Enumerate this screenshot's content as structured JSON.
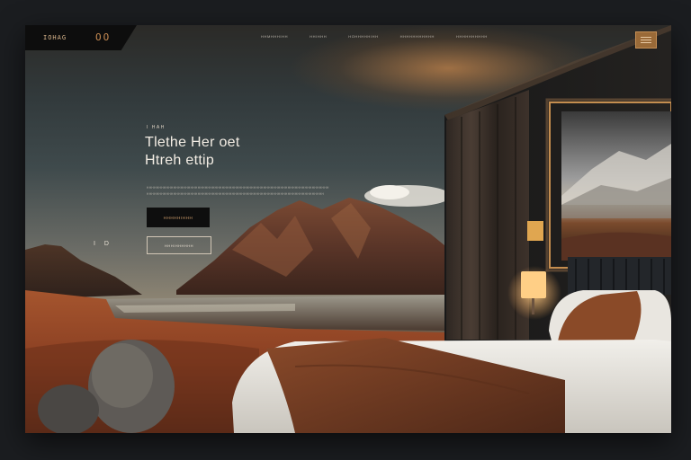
{
  "nav": {
    "logo_text": "IOHAG",
    "logo_mark": "OO",
    "items": [
      "HHMHHHIHH",
      "HHIHHH",
      "HOHHHHHIHH",
      "HHHHHHHHHHH",
      "HHHHHHHHHH"
    ]
  },
  "hero": {
    "eyebrow": "I HAH",
    "headline_line1": "Tlethe Her oet",
    "headline_line2": "Htreh ettip",
    "subcopy": "HHHHHHHHHHHHHHHHHHHHHHHHHHHHHHHHHHHHHHHHHHHHHHHHHHHHHHHHHHHHHHHHHHHHHHHHHHH HHHHHHHHHHHHHHHHHHHHHHHHHHHHHHHHHHHHHHHHHHHHHHHHHHHHHHHHHHHHHHHHHHHHHHHHH",
    "primary_button": "HHHHHIHHH",
    "secondary_button": "HHHIHHHHHH",
    "side_marker": "I D"
  },
  "colors": {
    "accent": "#c88b52",
    "dark": "#0e0e0e",
    "text_light": "#f3ede4"
  }
}
